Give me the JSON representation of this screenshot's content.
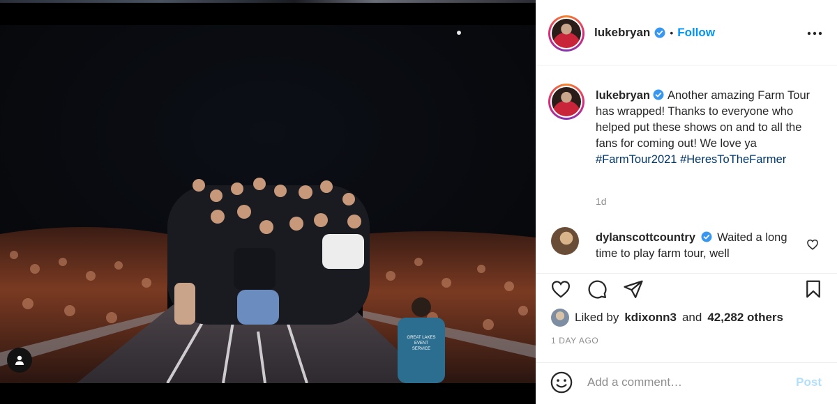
{
  "post": {
    "author": "lukebryan",
    "follow_label": "Follow",
    "separator": "•",
    "caption_text": "Another amazing Farm Tour has wrapped! Thanks to everyone who helped put these shows on and to all the fans for coming out! We love ya",
    "hashtags": [
      "#FarmTour2021",
      "#HeresToTheFarmer"
    ],
    "caption_age": "1d"
  },
  "comments": [
    {
      "user": "dylanscottcountry",
      "text": "Waited a long time to play farm tour, well"
    }
  ],
  "likes": {
    "prefix": "Liked by",
    "user": "kdixonn3",
    "connector": "and",
    "others": "42,282 others"
  },
  "post_date": "1 DAY AGO",
  "comment_box": {
    "placeholder": "Add a comment…",
    "post_label": "Post"
  },
  "photo_sign": {
    "line1": "GREAT LAKES",
    "line2": "EVENT",
    "line3": "SERVICE"
  },
  "icons": {
    "verified": "verified-badge-icon",
    "more": "more-options-icon",
    "heart": "heart-icon",
    "comment": "comment-icon",
    "share": "share-icon",
    "bookmark": "bookmark-icon",
    "emoji": "emoji-icon",
    "user_tag": "user-tag-icon"
  },
  "colors": {
    "accent": "#0095f6",
    "hashtag": "#00376b",
    "verified": "#3897f0",
    "muted": "#8e8e8e",
    "post_disabled": "#b2dffc"
  }
}
